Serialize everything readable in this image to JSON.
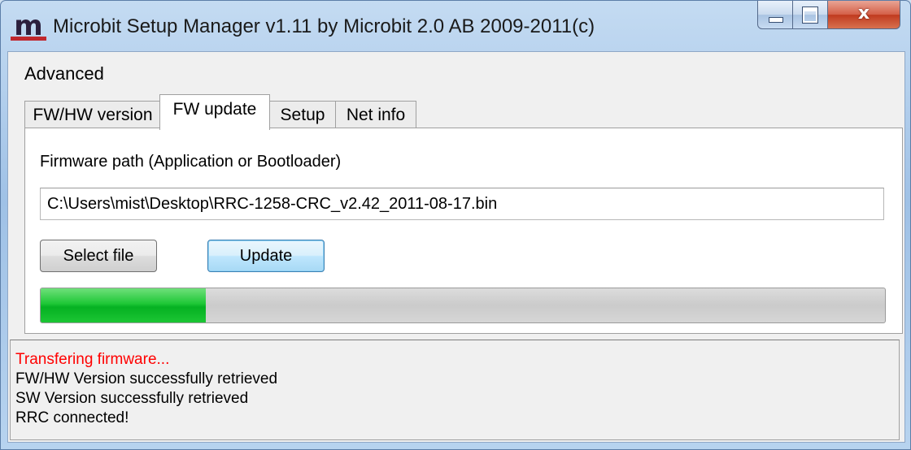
{
  "window": {
    "title": "Microbit Setup Manager v1.11 by Microbit 2.0 AB 2009-2011(c)",
    "logo_letter": "m",
    "close_glyph": "x"
  },
  "menu": {
    "items": [
      {
        "label": "Advanced"
      }
    ]
  },
  "tabs": [
    {
      "label": "FW/HW version",
      "active": false
    },
    {
      "label": "FW update",
      "active": true
    },
    {
      "label": "Setup",
      "active": false
    },
    {
      "label": "Net info",
      "active": false
    }
  ],
  "fw_update": {
    "path_label": "Firmware path (Application or Bootloader)",
    "path_value": "C:\\Users\\mist\\Desktop\\RRC-1258-CRC_v2.42_2011-08-17.bin",
    "select_file_label": "Select file",
    "update_label": "Update",
    "progress": 0.196
  },
  "log": {
    "lines": [
      {
        "text": "Transfering firmware...",
        "color": "#ff0000"
      },
      {
        "text": "FW/HW Version successfully retrieved",
        "color": "#000000"
      },
      {
        "text": "SW Version successfully retrieved",
        "color": "#000000"
      },
      {
        "text": "RRC connected!",
        "color": "#000000"
      }
    ]
  },
  "icons": {
    "logo": "microbit-logo-icon",
    "minimize": "minimize-icon",
    "maximize": "maximize-icon",
    "close": "close-icon"
  }
}
